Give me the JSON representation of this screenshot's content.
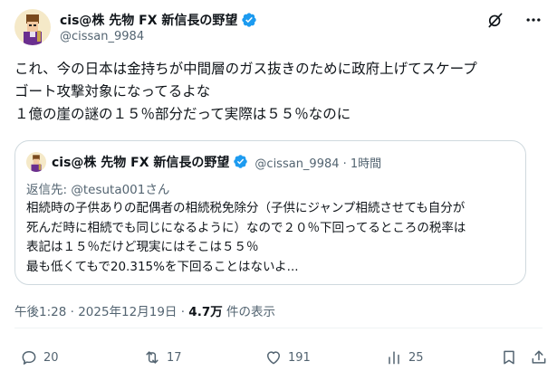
{
  "author": {
    "display_name": "cis@株 先物 FX 新信長の野望",
    "handle": "@cissan_9984"
  },
  "post": {
    "lines": [
      "これ、今の日本は金持ちが中間層のガス抜きのために政府上げてスケープ",
      "ゴート攻撃対象になってるよな",
      "１億の崖の謎の１５％部分だって実際は５５％なのに"
    ],
    "timestamp": "午後1:28 · 2025年12月19日",
    "view_count": "4.7万",
    "view_suffix": "件の表示"
  },
  "quote": {
    "display_name": "cis@株 先物 FX 新信長の野望",
    "handle_time": "@cissan_9984 · 1時間",
    "reply_to": "返信先: @tesuta001さん",
    "lines": [
      "相続時の子供ありの配偶者の相続税免除分（子供にジャンプ相続させても自分が",
      "死んだ時に相続でも同じになるように）なので２０％下回ってるところの税率は",
      "表記は１５％だけど現実にはそこは５５％",
      "最も低くてもで20.315%を下回ることはないよ..."
    ]
  },
  "actions": {
    "replies": "20",
    "reposts": "17",
    "likes": "191",
    "views": "25"
  },
  "icons": {
    "verified": "verified-badge-icon",
    "grok": "grok-icon",
    "more": "more-icon",
    "reply": "reply-icon",
    "repost": "repost-icon",
    "like": "like-icon",
    "analytics": "analytics-icon"
  },
  "colors": {
    "verified_blue": "#1d9bf0",
    "muted": "#536471",
    "text": "#0f1419",
    "border": "#cfd9de"
  }
}
